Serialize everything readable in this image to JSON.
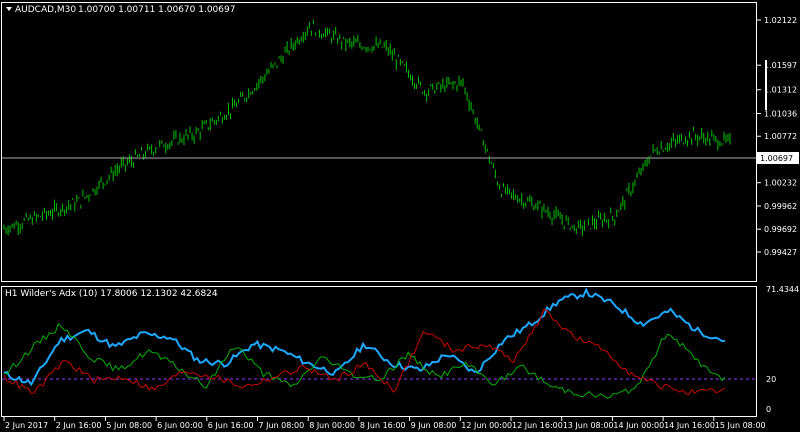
{
  "main": {
    "symbol": "AUDCAD,M30",
    "ohlc": "1.00700 1.00711 1.00670 1.00697",
    "title_icon": "dropdown-triangle-icon",
    "current_price_label": "1.00697",
    "price_ticks": [
      "1.02122",
      "1.01597",
      "1.01312",
      "1.01036",
      "1.00772",
      "1.00697",
      "1.00502",
      "1.00232",
      "0.99962",
      "0.99692",
      "0.99427"
    ]
  },
  "indicator": {
    "label": "H1 Wilder's Adx (10) 17.8006 12.1302 42.6824",
    "ticks": [
      "71.4344",
      "20",
      "0"
    ]
  },
  "xaxis": {
    "labels": [
      "2 Jun 2017",
      "2 Jun 16:00",
      "5 Jun 08:00",
      "6 Jun 00:00",
      "6 Jun 16:00",
      "7 Jun 08:00",
      "8 Jun 00:00",
      "8 Jun 16:00",
      "9 Jun 08:00",
      "12 Jun 00:00",
      "12 Jun 16:00",
      "13 Jun 08:00",
      "14 Jun 00:00",
      "14 Jun 16:00",
      "15 Jun 08:00"
    ]
  },
  "colors": {
    "background": "#000000",
    "price_bars": "#00c000",
    "adx_line": "#1fa8ff",
    "plus_di": "#00b000",
    "minus_di": "#cc0000",
    "level_line": "#9933ff",
    "axis": "#ffffff"
  },
  "chart_data": [
    {
      "type": "bar",
      "title": "AUDCAD,M30 1.00700 1.00711 1.00670 1.00697",
      "y_ticks": [
        0.99427,
        0.99692,
        0.99962,
        1.00232,
        1.00502,
        1.00772,
        1.01036,
        1.01312,
        1.01597,
        1.02122
      ],
      "current_price": 1.00697,
      "x": [
        "2 Jun 2017",
        "2 Jun 16:00",
        "5 Jun 08:00",
        "6 Jun 00:00",
        "6 Jun 16:00",
        "7 Jun 08:00",
        "8 Jun 00:00",
        "8 Jun 16:00",
        "9 Jun 08:00",
        "12 Jun 00:00",
        "12 Jun 16:00",
        "13 Jun 08:00",
        "14 Jun 00:00",
        "14 Jun 16:00",
        "15 Jun 08:00"
      ],
      "series": [
        {
          "values": [
            0.997,
            0.9985,
            1.0002,
            1.004,
            1.0065,
            1.008,
            1.011,
            1.0155,
            1.0205,
            1.0185,
            1.018,
            1.013,
            1.014,
            1.0015,
            0.9995,
            0.997,
            0.9985,
            1.006,
            1.0078,
            1.007
          ]
        }
      ]
    },
    {
      "type": "line",
      "title": "H1 Wilder's Adx (10) 17.8006 12.1302 42.6824",
      "y_ticks": [
        0,
        20,
        71.4344
      ],
      "levels": [
        20
      ],
      "series": [
        {
          "values": [
            22,
            16,
            42,
            48,
            38,
            46,
            44,
            30,
            28,
            40,
            36,
            28,
            22,
            40,
            28,
            24,
            34,
            22,
            42,
            52,
            66,
            71,
            64,
            52,
            60,
            48,
            42
          ]
        },
        {
          "values": [
            21,
            38,
            52,
            32,
            24,
            36,
            26,
            14,
            40,
            22,
            14,
            32,
            22,
            18,
            34,
            20,
            28,
            16,
            26,
            14,
            10,
            8,
            14,
            48,
            30,
            18
          ]
        },
        {
          "values": [
            20,
            10,
            30,
            18,
            20,
            12,
            24,
            20,
            14,
            20,
            26,
            18,
            28,
            12,
            48,
            36,
            40,
            30,
            60,
            44,
            36,
            20,
            14,
            10,
            12
          ]
        }
      ]
    }
  ]
}
